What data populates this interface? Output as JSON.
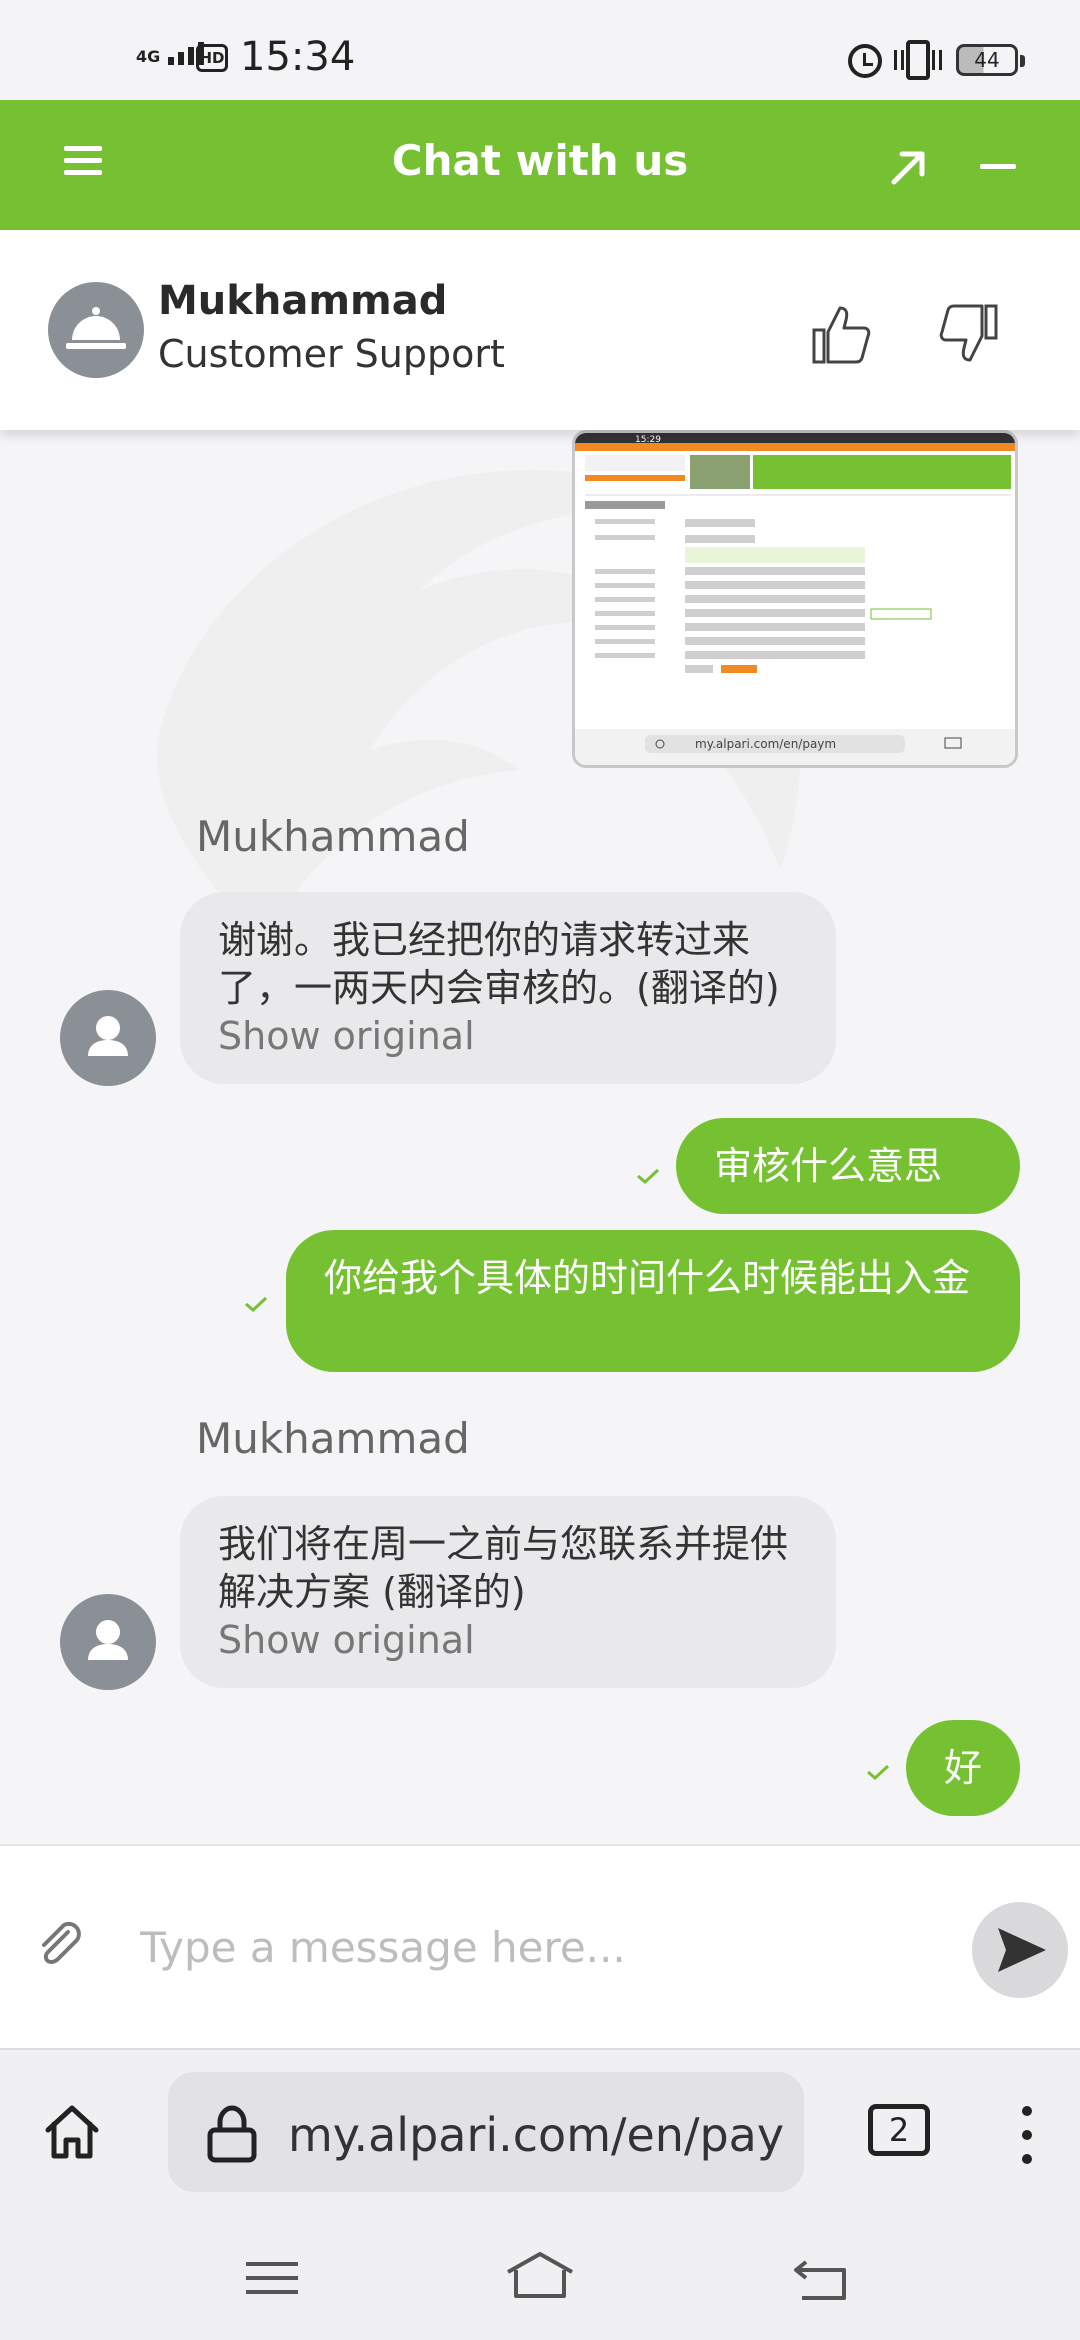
{
  "status_bar": {
    "time": "15:34",
    "network": "4G",
    "hd": "HD",
    "battery": "44"
  },
  "header": {
    "title": "Chat with us"
  },
  "agent": {
    "name": "Mukhammad",
    "role": "Customer Support"
  },
  "screenshot_attachment": {
    "status_time": "15:29",
    "url": "my.alpari.com/en/paym"
  },
  "messages": [
    {
      "sender": "Mukhammad",
      "text": "谢谢。我已经把你的请求转过来了，一两天内会审核的。(翻译的)",
      "show_original": "Show original"
    },
    {
      "sender": "me",
      "text": "审核什么意思"
    },
    {
      "sender": "me",
      "text": "你给我个具体的时间什么时候能出入金"
    },
    {
      "sender": "Mukhammad",
      "text": "我们将在周一之前与您联系并提供解决方案 (翻译的)",
      "show_original": "Show original"
    },
    {
      "sender": "me",
      "text": "好"
    }
  ],
  "input": {
    "placeholder": "Type a message here..."
  },
  "browser": {
    "url": "my.alpari.com/en/paym",
    "tab_count": "2"
  },
  "colors": {
    "accent": "#76c132",
    "incoming_bubble": "#e9e9eb",
    "avatar": "#8a9096"
  }
}
